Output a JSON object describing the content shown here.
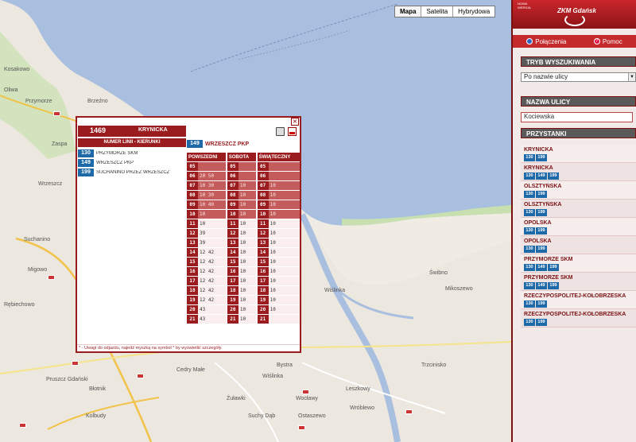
{
  "map": {
    "type_buttons": [
      "Mapa",
      "Satelita",
      "Hybrydowa"
    ],
    "labels": [
      {
        "text": "Kosakowo"
      },
      {
        "text": "Przymorze"
      },
      {
        "text": "Oliwa"
      },
      {
        "text": "Brzeźno"
      },
      {
        "text": "Zaspa"
      },
      {
        "text": "Wrzeszcz"
      },
      {
        "text": "Suchanino"
      },
      {
        "text": "Migowo"
      },
      {
        "text": "Rębiechowo"
      },
      {
        "text": "Wiślinka"
      },
      {
        "text": "Świbno"
      },
      {
        "text": "Mikoszewo"
      },
      {
        "text": "Błotnik"
      },
      {
        "text": "Cedry Małe"
      },
      {
        "text": "Kolbudy"
      },
      {
        "text": "Pruszcz Gdański"
      },
      {
        "text": "Wocławy"
      },
      {
        "text": "Leszkowy"
      },
      {
        "text": "Żuławki"
      },
      {
        "text": "Suchy Dąb"
      },
      {
        "text": "Ostaszewo"
      },
      {
        "text": "Trzcinisko"
      },
      {
        "text": "Wróblewo"
      },
      {
        "text": "Bystra"
      },
      {
        "text": "Wiślinka"
      }
    ]
  },
  "popup": {
    "stop_id": "1469",
    "stop_name": "KRYNICKA",
    "line_dir_header": "NUMER LINII - KIERUNKI",
    "routes": [
      {
        "line": "130",
        "dir": "PRZYMORZE SKM"
      },
      {
        "line": "149",
        "dir": "WRZESZCZ PKP"
      },
      {
        "line": "199",
        "dir": "SUCHANINO PRZEZ WRZESZCZ"
      }
    ],
    "current": {
      "line": "149",
      "dir": "WRZESZCZ PKP"
    },
    "columns": [
      "POWSZEDNI",
      "SOBOTA",
      "ŚWIĄTECZNY"
    ],
    "rows": [
      [
        {
          "h": "05",
          "m": ""
        },
        {
          "h": "05",
          "m": ""
        },
        {
          "h": "05",
          "m": ""
        }
      ],
      [
        {
          "h": "06",
          "m": "20 50"
        },
        {
          "h": "06",
          "m": ""
        },
        {
          "h": "06",
          "m": ""
        }
      ],
      [
        {
          "h": "07",
          "m": "10 30"
        },
        {
          "h": "07",
          "m": "10"
        },
        {
          "h": "07",
          "m": "10"
        }
      ],
      [
        {
          "h": "08",
          "m": "10 30"
        },
        {
          "h": "08",
          "m": "10"
        },
        {
          "h": "08",
          "m": "10"
        }
      ],
      [
        {
          "h": "09",
          "m": "10 40"
        },
        {
          "h": "09",
          "m": "10"
        },
        {
          "h": "09",
          "m": "10"
        }
      ],
      [
        {
          "h": "10",
          "m": "10"
        },
        {
          "h": "10",
          "m": "10"
        },
        {
          "h": "10",
          "m": "10"
        }
      ],
      [
        {
          "h": "11",
          "m": "10"
        },
        {
          "h": "11",
          "m": "10"
        },
        {
          "h": "11",
          "m": "10"
        }
      ],
      [
        {
          "h": "12",
          "m": "39"
        },
        {
          "h": "12",
          "m": "10"
        },
        {
          "h": "12",
          "m": "10"
        }
      ],
      [
        {
          "h": "13",
          "m": "39"
        },
        {
          "h": "13",
          "m": "10"
        },
        {
          "h": "13",
          "m": "10"
        }
      ],
      [
        {
          "h": "14",
          "m": "12 42"
        },
        {
          "h": "14",
          "m": "10"
        },
        {
          "h": "14",
          "m": "10"
        }
      ],
      [
        {
          "h": "15",
          "m": "12 42"
        },
        {
          "h": "15",
          "m": "10"
        },
        {
          "h": "15",
          "m": "10"
        }
      ],
      [
        {
          "h": "16",
          "m": "12 42"
        },
        {
          "h": "16",
          "m": "10"
        },
        {
          "h": "16",
          "m": "10"
        }
      ],
      [
        {
          "h": "17",
          "m": "12 42"
        },
        {
          "h": "17",
          "m": "10"
        },
        {
          "h": "17",
          "m": "10"
        }
      ],
      [
        {
          "h": "18",
          "m": "12 42"
        },
        {
          "h": "18",
          "m": "10"
        },
        {
          "h": "18",
          "m": "10"
        }
      ],
      [
        {
          "h": "19",
          "m": "12 42"
        },
        {
          "h": "19",
          "m": "10"
        },
        {
          "h": "19",
          "m": "10"
        }
      ],
      [
        {
          "h": "20",
          "m": "43"
        },
        {
          "h": "20",
          "m": "10"
        },
        {
          "h": "20",
          "m": "10"
        }
      ],
      [
        {
          "h": "21",
          "m": "43"
        },
        {
          "h": "21",
          "m": "10"
        },
        {
          "h": "21",
          "m": ""
        }
      ]
    ],
    "footer": "* - Uwagi do odjazdu, najedź myszką na symbol * by wyświetlić szczegóły."
  },
  "panel": {
    "header_small": "NOWA\nWERSJA",
    "logo": "ZKM Gdańsk",
    "nav": {
      "connections": "Połączenia",
      "help": "Pomoc"
    },
    "search_mode_title": "TRYB WYSZUKIWANIA",
    "search_mode_value": "Po nazwie ulicy",
    "street_title": "NAZWA ULICY",
    "street_value": "Kociewska",
    "stops_title": "PRZYSTANKI",
    "stops": [
      {
        "name": "KRYNICKA",
        "lines": [
          "130",
          "199"
        ]
      },
      {
        "name": "KRYNICKA",
        "lines": [
          "130",
          "149",
          "199"
        ]
      },
      {
        "name": "OLSZTYŃSKA",
        "lines": [
          "130",
          "199"
        ]
      },
      {
        "name": "OLSZTYŃSKA",
        "lines": [
          "130",
          "199"
        ]
      },
      {
        "name": "OPOLSKA",
        "lines": [
          "130",
          "199"
        ]
      },
      {
        "name": "OPOLSKA",
        "lines": [
          "130",
          "199"
        ]
      },
      {
        "name": "PRZYMORZE SKM",
        "lines": [
          "130",
          "149",
          "199"
        ]
      },
      {
        "name": "PRZYMORZE SKM",
        "lines": [
          "130",
          "149",
          "199"
        ]
      },
      {
        "name": "RZECZYPOSPOLITEJ-KOŁOBRZESKA",
        "lines": [
          "130",
          "199"
        ]
      },
      {
        "name": "RZECZYPOSPOLITEJ-KOŁOBRZESKA",
        "lines": [
          "130",
          "199"
        ]
      }
    ]
  },
  "colors": {
    "accent": "#9a1c1f",
    "line_badge": "#1e6aa8",
    "sea": "#a9bfdf"
  }
}
